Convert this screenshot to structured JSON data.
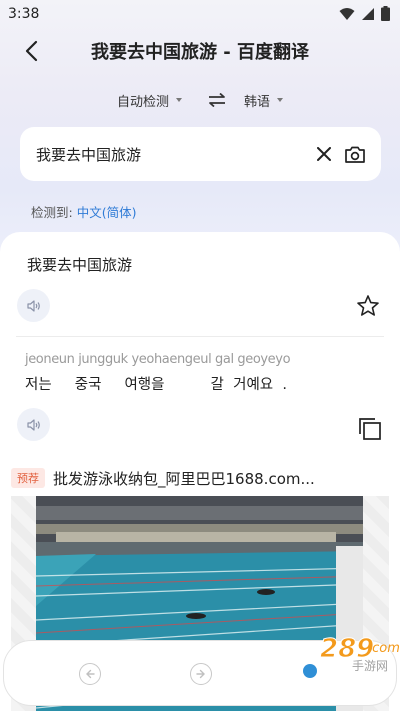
{
  "status": {
    "time": "3:38"
  },
  "header": {
    "title": "我要去中国旅游 - 百度翻译"
  },
  "lang_bar": {
    "source_lang": "自动检测",
    "target_lang": "韩语"
  },
  "input": {
    "text": "我要去中国旅游"
  },
  "detected": {
    "label": "检测到:",
    "language": "中文(简体)"
  },
  "result": {
    "source_text": "我要去中国旅游",
    "romanization": "jeoneun jungguk yeohaengeul gal geoyeyo",
    "translation": "저는     중국     여행을          갈  거예요  ."
  },
  "ad": {
    "badge": "预荐",
    "title": "批发游泳收纳包_阿里巴巴1688.com..."
  },
  "watermark": {
    "text": "289",
    "suffix": ".com",
    "sub": "手游网"
  },
  "colors": {
    "accent": "#2f7bd6",
    "badge_bg": "#fde8e4",
    "badge_fg": "#e2613f"
  }
}
